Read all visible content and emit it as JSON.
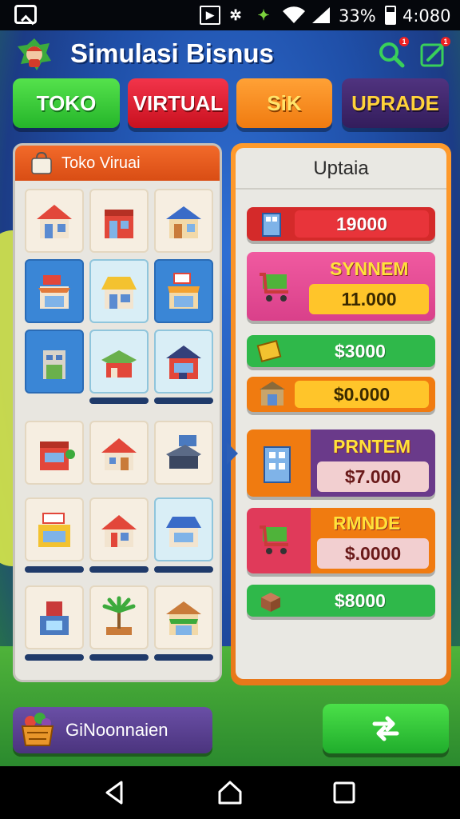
{
  "status_bar": {
    "battery_percent": "33%",
    "time": "4:080"
  },
  "header": {
    "title": "Simulasi Bisnus",
    "search_badge": "1",
    "edit_badge": "1"
  },
  "tabs": [
    {
      "label": "TOKO"
    },
    {
      "label": "VIRTUAL"
    },
    {
      "label": "SiK"
    },
    {
      "label": "UPRADE"
    }
  ],
  "left_panel": {
    "title": "Toko Viruai",
    "icon": "shopping-bag-icon"
  },
  "right_panel": {
    "title": "Uptaia",
    "items": [
      {
        "price": "19000"
      },
      {
        "label": "SYNNEM",
        "price": "11.000"
      },
      {
        "price": "$3000"
      },
      {
        "price": "$0.000"
      },
      {
        "label": "PRNTEM",
        "price": "$7.000"
      },
      {
        "label": "RMNDE",
        "price": "$.0000"
      },
      {
        "price": "$8000"
      }
    ]
  },
  "bottom": {
    "basket_label": "GiNoonnaien",
    "swap_icon": "swap-icon"
  },
  "colors": {
    "green": "#25b52a",
    "red": "#c9111f",
    "orange": "#f07b10",
    "purple": "#331d5c",
    "yellow_text": "#ffd23a"
  }
}
